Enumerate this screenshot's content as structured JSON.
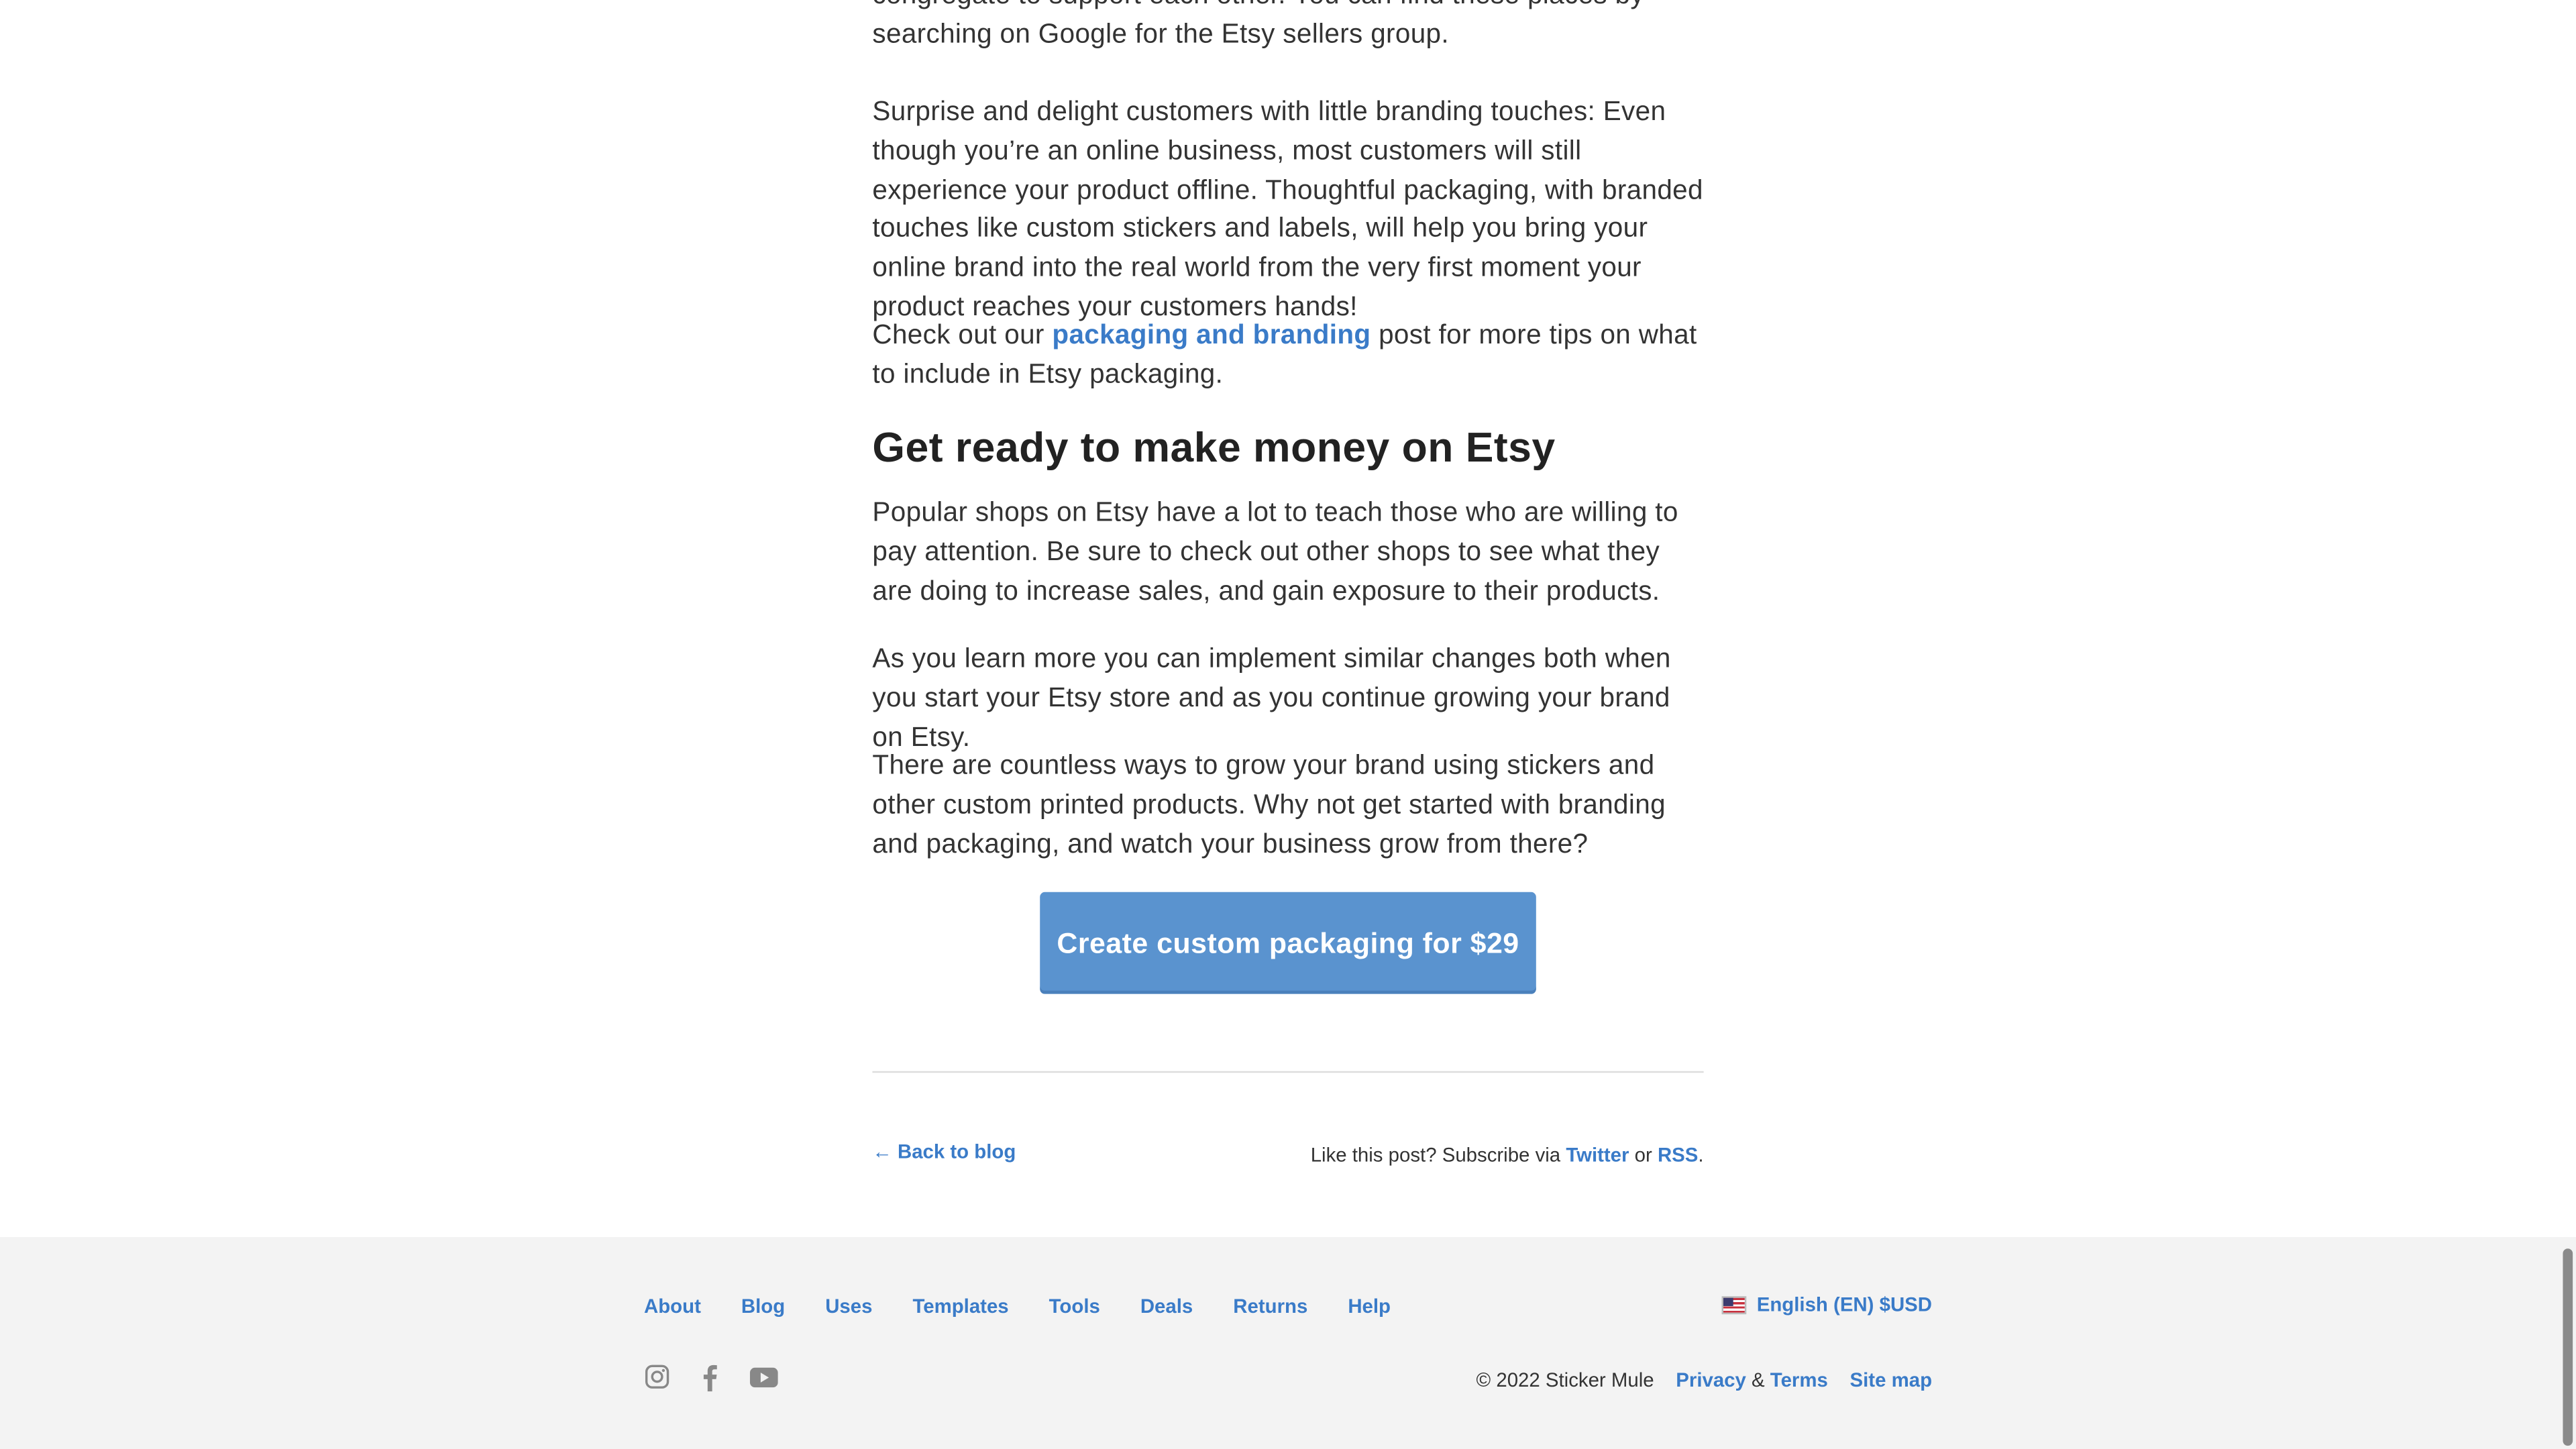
{
  "article": {
    "para_top_partial": "congregate to support each other. You can find these places by searching on Google for the Etsy sellers group.",
    "para_surprise": "Surprise and delight customers with little branding touches: Even though you’re an online business, most customers will still experience your product offline. Thoughtful packaging, with branded touches like custom stickers and labels, will help you bring your online brand into the real world from the very first moment your product reaches your customers hands!",
    "check_out_prefix": "Check out our ",
    "check_out_link": "packaging and branding",
    "check_out_suffix": " post for more tips on what to include in Etsy packaging.",
    "heading": "Get ready to make money on Etsy",
    "para_popular": "Popular shops on Etsy have a lot to teach those who are willing to pay attention. Be sure to check out other shops to see what they are doing to increase sales, and gain exposure to their products.",
    "para_learn": "As you learn more you can implement similar changes both when you start your Etsy store and as you continue growing your brand on Etsy.",
    "para_countless": "There are countless ways to grow your brand using stickers and other custom printed products. Why not get started with branding and packaging, and watch your business grow from there?",
    "cta_label": "Create custom packaging for $29"
  },
  "post_footer": {
    "back_label": "← Back to blog",
    "subscribe_prefix": "Like this post? Subscribe via ",
    "twitter": "Twitter",
    "or": " or ",
    "rss": "RSS",
    "period": "."
  },
  "footer": {
    "nav": [
      "About",
      "Blog",
      "Uses",
      "Templates",
      "Tools",
      "Deals",
      "Returns",
      "Help"
    ],
    "language": "English (EN) $USD",
    "copyright": "© 2022 Sticker Mule",
    "privacy": "Privacy",
    "amp": " & ",
    "terms": "Terms",
    "sitemap": "Site map",
    "social_icons": [
      "instagram-icon",
      "facebook-icon",
      "youtube-icon"
    ]
  },
  "colors": {
    "link": "#3a7bc8",
    "cta": "#5a93cf",
    "footer_bg": "#f3f3f3"
  }
}
